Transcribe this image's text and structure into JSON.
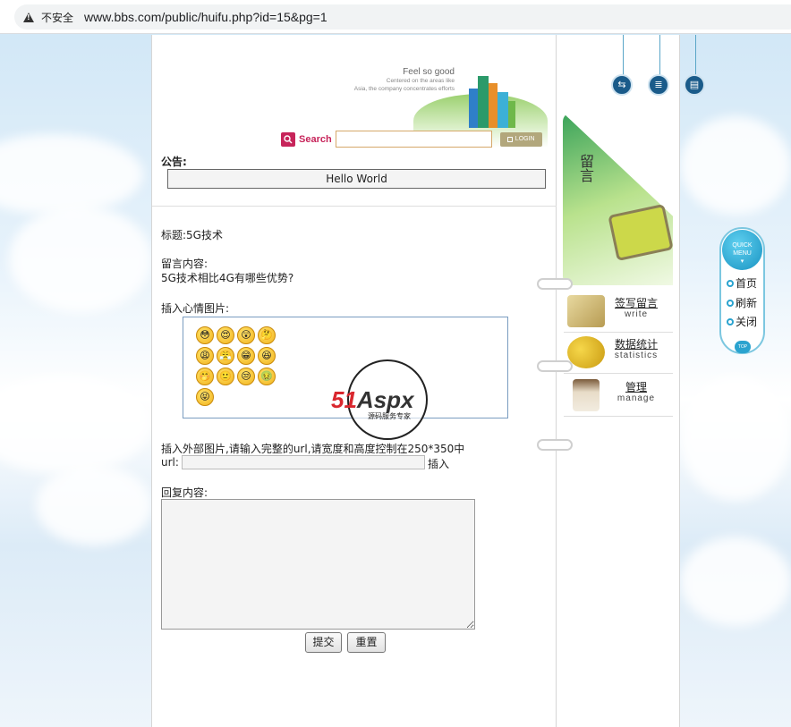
{
  "browser": {
    "security_label": "不安全",
    "url": "www.bbs.com/public/huifu.php?id=15&pg=1",
    "back_glyph": "C"
  },
  "header": {
    "slogan": "Feel so good",
    "tagline_1": "Centered on the areas like",
    "tagline_2": "Asia, the company concentrates efforts",
    "search_label": "Search",
    "login_label": "LOGIN"
  },
  "notice": {
    "title": "公告:",
    "content": "Hello World"
  },
  "post": {
    "title_line": "标题:5G技术",
    "content_label": "留言内容:",
    "content_text": "5G技术相比4G有哪些优势?"
  },
  "form": {
    "emoji_label": "插入心情图片:",
    "ext_image_label": "插入外部图片,请输入完整的url,请宽度和高度控制在250*350中",
    "url_label": "url:",
    "insert_label": "插入",
    "reply_label": "回复内容:",
    "submit_label": "提交",
    "reset_label": "重置"
  },
  "emojis": [
    "😳",
    "😍",
    "😲",
    "🤔",
    "😩",
    "😤",
    "😁",
    "😆",
    "🤭",
    "🙂",
    "😒",
    "🤢",
    "😝"
  ],
  "watermark": {
    "brand_red": "51",
    "brand_dark": "Aspx",
    "sub": "源码服务专家",
    "color_red": "#d9272e",
    "color_green": "#3aa14b"
  },
  "sidebar": {
    "tab_label": "留言",
    "items": [
      {
        "cn": "签写留言",
        "en": "write"
      },
      {
        "cn": "数据统计",
        "en": "statistics"
      },
      {
        "cn": "管理",
        "en": "manage"
      }
    ],
    "top_icons": [
      "sitemap-icon",
      "list-icon",
      "page-icon"
    ]
  },
  "quick_menu": {
    "title_1": "QUICK",
    "title_2": "MENU",
    "items": [
      "首页",
      "刷新",
      "关闭"
    ],
    "top_label": "TOP"
  },
  "colors": {
    "search_accent": "#c7245a",
    "login_bg": "#b2a77c",
    "quick_accent": "#2aa3cf"
  }
}
